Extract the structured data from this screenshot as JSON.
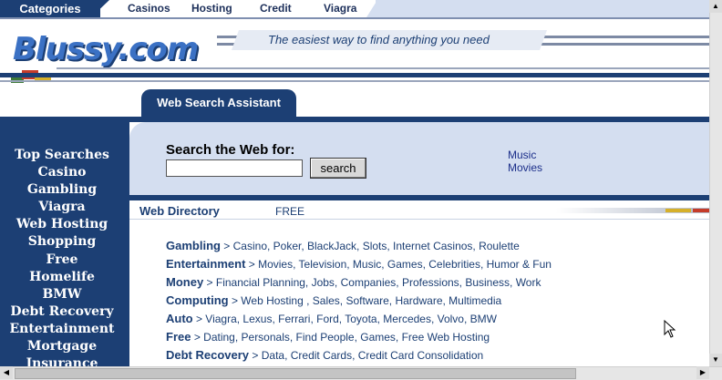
{
  "topnav": {
    "categories_label": "Categories",
    "links": [
      "Casinos",
      "Hosting",
      "Credit",
      "Viagra"
    ]
  },
  "header": {
    "logo_text": "Blussy.com",
    "tagline": "The easiest way to find anything you need"
  },
  "search_section": {
    "tab_label": "Web Search Assistant",
    "label": "Search the Web for:",
    "input_value": "",
    "button_label": "search",
    "quick_links": [
      "Music",
      "Movies"
    ]
  },
  "sidebar": {
    "items": [
      "Top Searches",
      "Casino",
      "Gambling",
      "Viagra",
      "Web Hosting",
      "Shopping",
      "Free",
      "Homelife",
      "BMW",
      "Debt Recovery",
      "Entertainment",
      "Mortgage",
      "Insurance"
    ]
  },
  "directory": {
    "title": "Web Directory",
    "badge": "FREE",
    "rows": [
      {
        "category": "Gambling",
        "links": "> Casino, Poker, BlackJack, Slots, Internet Casinos, Roulette"
      },
      {
        "category": "Entertainment",
        "links": "> Movies, Television, Music, Games, Celebrities, Humor & Fun"
      },
      {
        "category": "Money",
        "links": "> Financial Planning, Jobs, Companies, Professions, Business, Work"
      },
      {
        "category": "Computing",
        "links": "> Web Hosting , Sales, Software, Hardware, Multimedia"
      },
      {
        "category": "Auto",
        "links": "> Viagra, Lexus, Ferrari, Ford, Toyota, Mercedes, Volvo, BMW"
      },
      {
        "category": "Free",
        "links": "> Dating, Personals, Find People, Games, Free Web Hosting"
      },
      {
        "category": "Debt Recovery",
        "links": " > Data, Credit Cards, Credit Card Consolidation"
      }
    ]
  },
  "colors": {
    "navy": "#1c3f74",
    "panel": "#d4def0",
    "logo_blue": "#3b71c4"
  }
}
